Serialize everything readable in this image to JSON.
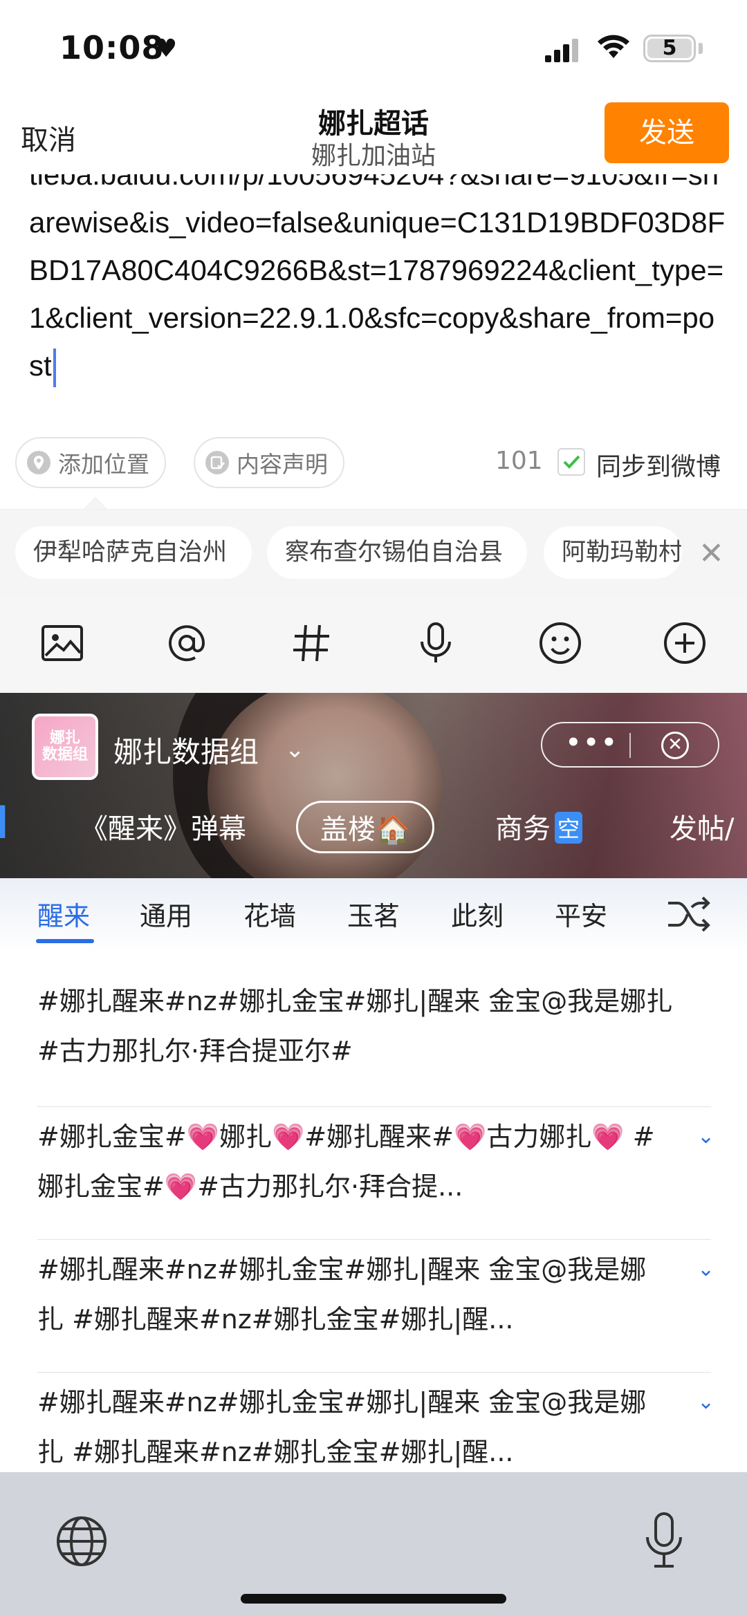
{
  "status_bar": {
    "time": "10:08",
    "battery": "5"
  },
  "header": {
    "cancel_label": "取消",
    "title": "娜扎超话",
    "subtitle": "娜扎加油站",
    "send_label": "发送"
  },
  "editor": {
    "text": "tieba.baidu.com/p/10056945204?&share=9105&fr=sharewise&is_video=false&unique=C131D19BDF03D8FBD17A80C404C9266B&st=1787969224&client_type=1&client_version=22.9.1.0&sfc=copy&share_from=post"
  },
  "options": {
    "add_location": "添加位置",
    "content_statement": "内容声明",
    "word_count": "101",
    "sync_label": "同步到微博"
  },
  "location_suggestions": [
    "伊犁哈萨克自治州",
    "察布查尔锡伯自治县",
    "阿勒玛勒村"
  ],
  "toolbar": {
    "icons": [
      "image-icon",
      "at-icon",
      "hashtag-icon",
      "microphone-icon",
      "emoji-icon",
      "plus-icon"
    ]
  },
  "keyboard_panel": {
    "avatar_text": "娜扎\n数据组",
    "group_name": "娜扎数据组",
    "categories": [
      "《醒来》弹幕",
      "盖楼🏠",
      "商务",
      "发帖/"
    ],
    "kong_badge": "空",
    "accent_color": "#2b6de6",
    "tabs": [
      "醒来",
      "通用",
      "花墙",
      "玉茗",
      "此刻",
      "平安"
    ],
    "phrases": [
      "#娜扎醒来#nz#娜扎金宝#娜扎|醒来 金宝@我是娜扎 #古力那扎尔·拜合提亚尔#",
      "#娜扎金宝#💗娜扎💗#娜扎醒来#💗古力娜扎💗 #娜扎金宝#💗#古力那扎尔·拜合提...",
      "#娜扎醒来#nz#娜扎金宝#娜扎|醒来 金宝@我是娜扎 #娜扎醒来#nz#娜扎金宝#娜扎|醒...",
      "#娜扎醒来#nz#娜扎金宝#娜扎|醒来 金宝@我是娜扎 #娜扎醒来#nz#娜扎金宝#娜扎|醒..."
    ]
  },
  "colors": {
    "send_button": "#ff8200",
    "keyboard_bg": "#d1d4db"
  }
}
